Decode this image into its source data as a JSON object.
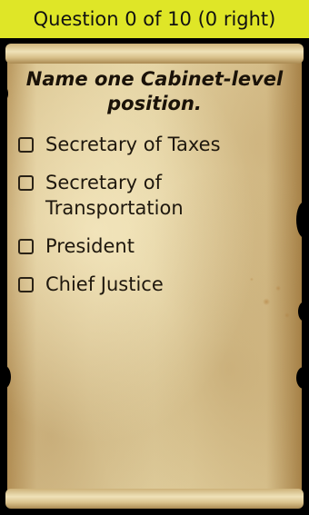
{
  "header": {
    "progress_text": "Question 0 of 10 (0 right)"
  },
  "quiz": {
    "question": "Name one Cabinet-level position.",
    "options": [
      {
        "label": "Secretary of Taxes",
        "checked": false
      },
      {
        "label": "Secretary of Transportation",
        "checked": false
      },
      {
        "label": "President",
        "checked": false
      },
      {
        "label": "Chief Justice",
        "checked": false
      }
    ]
  },
  "colors": {
    "header_bg": "#dfe627",
    "parchment": "#e6d6a6",
    "text": "#1a1208"
  }
}
